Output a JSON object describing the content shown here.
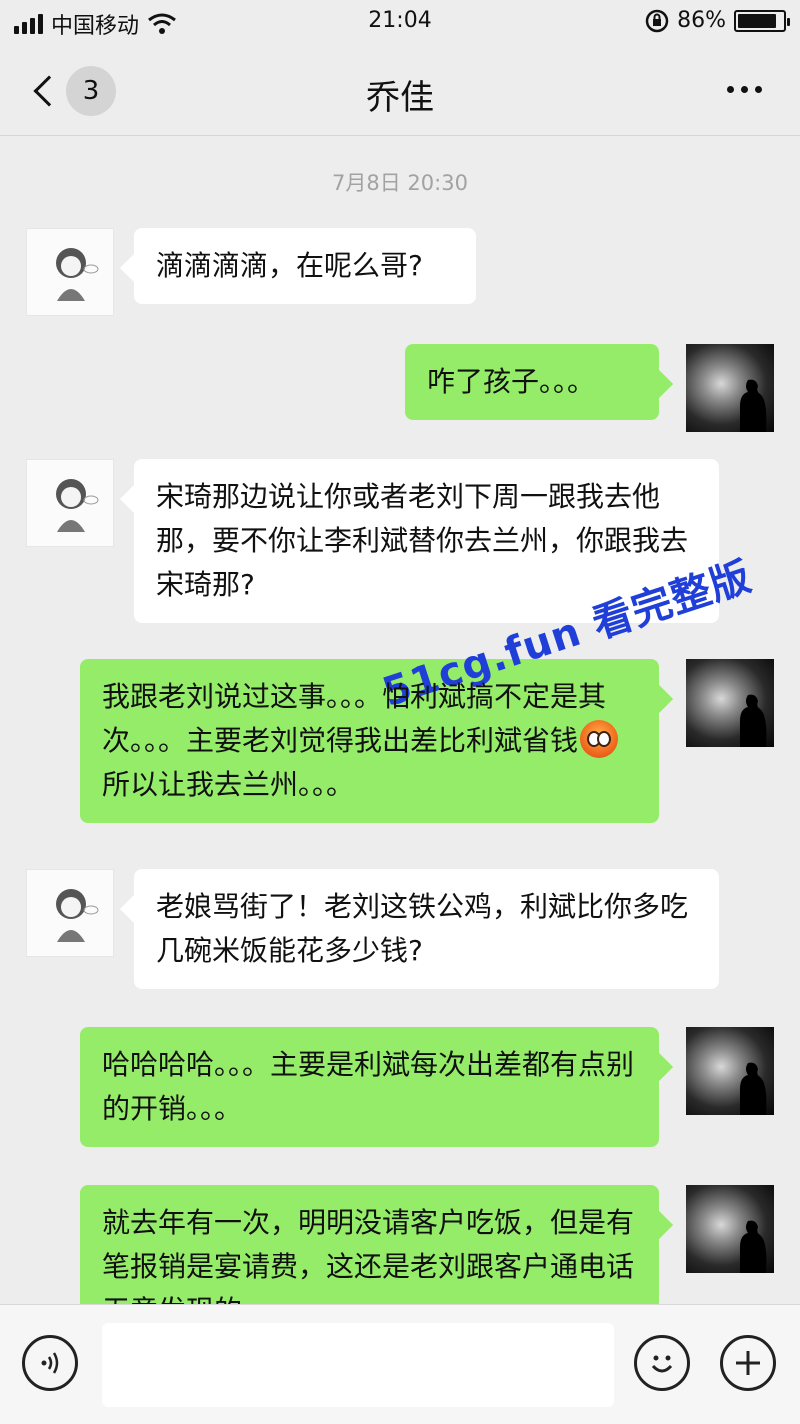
{
  "status_bar": {
    "carrier": "中国移动",
    "time": "21:04",
    "battery_text": "86%",
    "battery_level": 0.86,
    "icons": [
      "signal-icon",
      "wifi-icon",
      "orientation-lock-icon",
      "battery-icon"
    ]
  },
  "nav": {
    "unread_count": "3",
    "title": "乔佳",
    "back_icon": "chevron-left-icon",
    "more_icon": "more-dots-icon"
  },
  "chat": {
    "timestamp": "7月8日 20:30",
    "messages": [
      {
        "side": "in",
        "text": "滴滴滴滴，在呢么哥?"
      },
      {
        "side": "out",
        "text": "咋了孩子。。。"
      },
      {
        "side": "in",
        "text": "宋琦那边说让你或者老刘下周一跟我去他那，要不你让李利斌替你去兰州，你跟我去宋琦那?"
      },
      {
        "side": "out",
        "text_before": "我跟老刘说过这事。。。怕利斌搞不定是其次。。。主要老刘觉得我出差比利斌省钱",
        "emoji": "flushed-face-emoji",
        "text_after": "所以让我去兰州。。。"
      },
      {
        "side": "in",
        "text": "老娘骂街了！老刘这铁公鸡，利斌比你多吃几碗米饭能花多少钱?"
      },
      {
        "side": "out",
        "text": "哈哈哈哈。。。主要是利斌每次出差都有点别的开销。。。"
      },
      {
        "side": "out",
        "text": "就去年有一次，明明没请客户吃饭，但是有笔报销是宴请费，这还是老刘跟客户通电话无意发现的"
      }
    ]
  },
  "watermark": "51cg.fun 看完整版",
  "input_bar": {
    "voice_icon": "voice-icon",
    "emoji_icon": "smiley-icon",
    "plus_icon": "plus-icon"
  },
  "colors": {
    "background": "#ededed",
    "incoming_bubble": "#ffffff",
    "outgoing_bubble": "#95ec69",
    "timestamp": "#a2a2a2",
    "watermark": "#1f3fd8"
  }
}
